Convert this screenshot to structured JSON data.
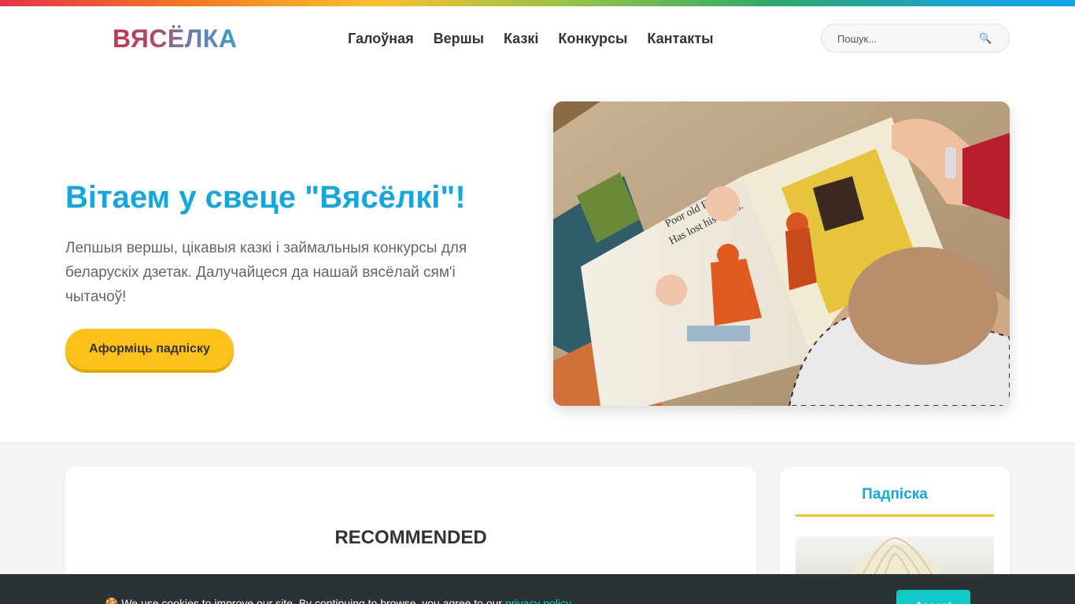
{
  "header": {
    "logo": "ВЯСЁЛКА",
    "nav": [
      "Галоўная",
      "Вершы",
      "Казкі",
      "Конкурсы",
      "Кантакты"
    ],
    "search_placeholder": "Пошук...",
    "search_icon": "search-icon"
  },
  "hero": {
    "title": "Вітаем у свеце \"Вясёлкі\"!",
    "text": "Лепшыя вершы, цікавыя казкі і займальныя конкурсы для беларускіх дзетак. Далучайцеся да нашай вясёлай сям'і чытачоў!",
    "cta": "Аформіць падпіску",
    "image_caption_line1": "Poor old Fox",
    "image_caption_line2": "Has lost his socks."
  },
  "main": {
    "recommended_title": "RECOMMENDED"
  },
  "sidebar": {
    "title": "Падпіска"
  },
  "cookie": {
    "text": "🍪 We use cookies to improve our site. By continuing to browse, you agree to our ",
    "link": "privacy policy",
    "tail": ".",
    "accept": "Accept"
  },
  "colors": {
    "accent_blue": "#12a7df",
    "accent_yellow": "#fbc21b",
    "cookie_bg": "#2b3235",
    "accept_bg": "#12c9c9"
  }
}
